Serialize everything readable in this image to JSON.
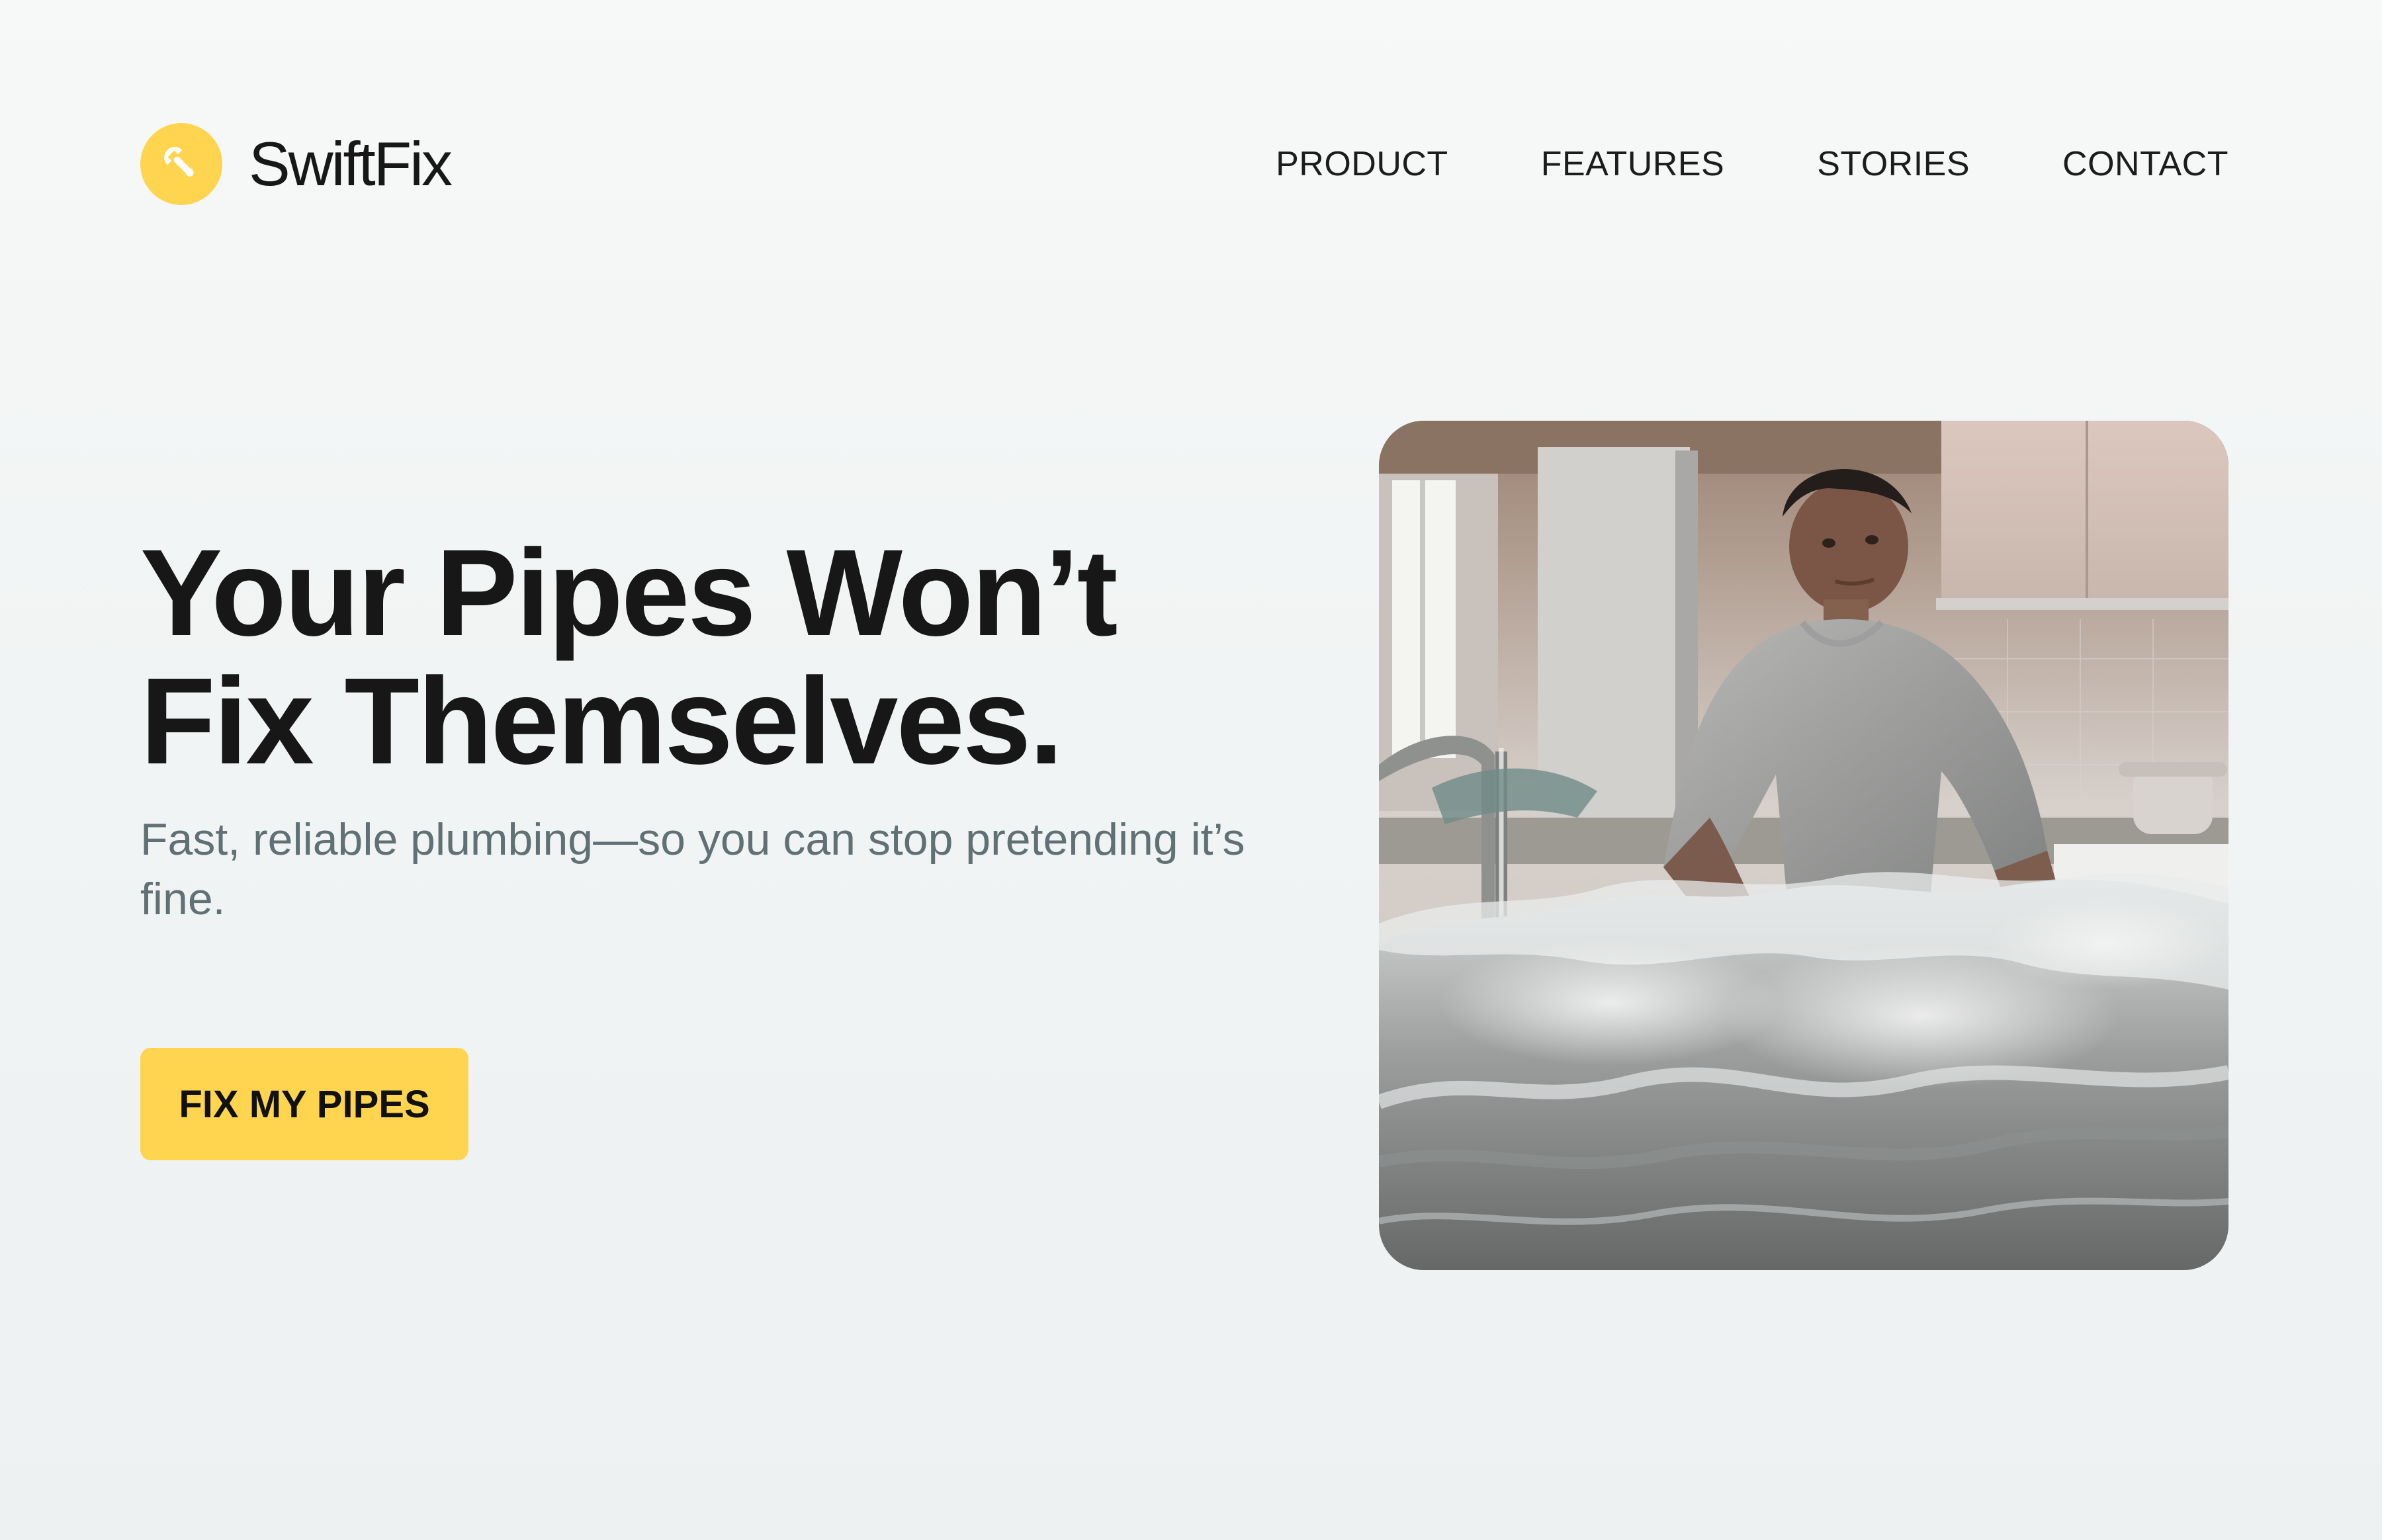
{
  "brand": {
    "name": "SwiftFix",
    "logo_icon": "wrench-icon",
    "accent_color": "#ffd54f"
  },
  "nav": {
    "items": [
      {
        "label": "PRODUCT"
      },
      {
        "label": "FEATURES"
      },
      {
        "label": "STORIES"
      },
      {
        "label": "CONTACT"
      }
    ]
  },
  "hero": {
    "title_line1": "Your Pipes Won’t",
    "title_line2": "Fix Themselves.",
    "subtitle": "Fast, reliable plumbing—so you can stop pretending it’s fine.",
    "cta_label": "FIX MY PIPES"
  },
  "colors": {
    "text": "#171717",
    "subtitle": "#617074",
    "background": "#f3f5f5"
  }
}
